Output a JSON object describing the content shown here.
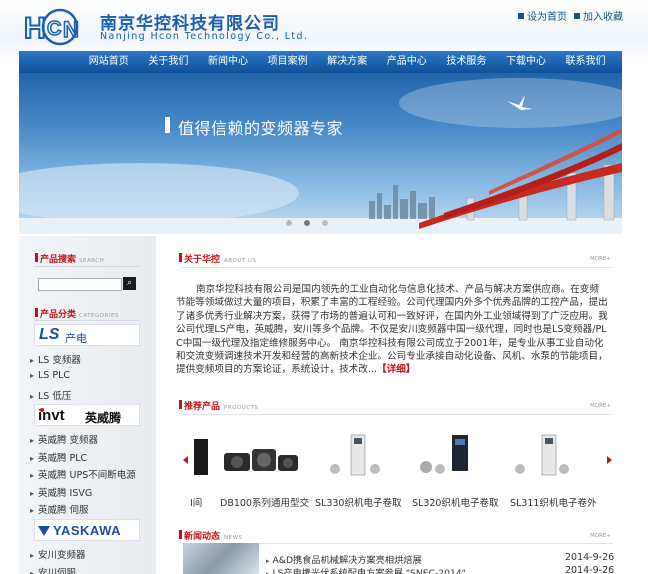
{
  "header": {
    "logo_text": "HCON",
    "company_cn": "南京华控科技有限公司",
    "company_en": "Nanjing Hcon Technology Co., Ltd.",
    "home_link": "设为首页",
    "fav_link": "加入收藏"
  },
  "nav": [
    "网站首页",
    "关于我们",
    "新闻中心",
    "项目案例",
    "解决方案",
    "产品中心",
    "技术服务",
    "下载中心",
    "联系我们"
  ],
  "banner": {
    "slogan": "值得信赖的变频器专家"
  },
  "left": {
    "search": {
      "title": "产品搜索",
      "en": "SEARCH",
      "placeholder": "",
      "button": "🔍"
    },
    "category": {
      "title": "产品分类",
      "en": "CATEGORIES"
    },
    "brands": [
      {
        "name": "LS产电",
        "items": [
          "LS 变频器",
          "LS PLC",
          "LS 低压"
        ]
      },
      {
        "name": "英威腾",
        "items": [
          "英威腾 变频器",
          "英威腾 PLC",
          "英威腾 UPS不间断电源",
          "英威腾 ISVG",
          "英威腾 伺服"
        ]
      },
      {
        "name": "YASKAWA",
        "items": [
          "安川变频器",
          "安川伺服"
        ]
      }
    ]
  },
  "about": {
    "title": "关于华控",
    "en": "ABOUT US",
    "more": "MORE+",
    "text": "南京华控科技有限公司是国内领先的工业自动化与信息化技术、产品与解决方案供应商。在变频节能等领域做过大量的项目，积累了丰富的工程经验。公司代理国内外多个优秀品牌的工控产品，提出了诸多优秀行业解决方案，获得了市场的普遍认可和一致好评，在国内外工业领域得到了广泛应用。我公司代理LS产电，英威腾，安川等多个品牌。不仅是安川变频器中国一级代理，同时也是LS变频器/PLC中国一级代理及指定维修服务中心。  南京华控科技有限公司成立于2001年，是专业从事工业自动化和交流变频调速技术开发和经营的高新技术企业。公司专业承接自动化设备、风机、水泵的节能项目，提供变频项目的方案论证，系统设计，技术改...",
    "detail": "【详细】"
  },
  "products": {
    "title": "推荐产品",
    "en": "PRODUCTS",
    "more": "MORE+",
    "items": [
      "I间",
      "DB100系列通用型交",
      "SL330织机电子卷取",
      "SL320织机电子卷取",
      "SL311织机电子卷外"
    ]
  },
  "news": {
    "title": "新闻动态",
    "en": "NEWS",
    "more": "MORE+",
    "items": [
      {
        "title": "A&D携食品机械解决方案亮相烘焙展",
        "date": "2014-9-26"
      },
      {
        "title": "LS产电携光伏系统配电方案参展 \"SNEC-2014\"",
        "date": "2014-9-26"
      }
    ]
  },
  "colors": {
    "brand_blue": "#1b5fb1",
    "accent_red": "#c0161a",
    "nav_blue": "#0f4f98"
  }
}
